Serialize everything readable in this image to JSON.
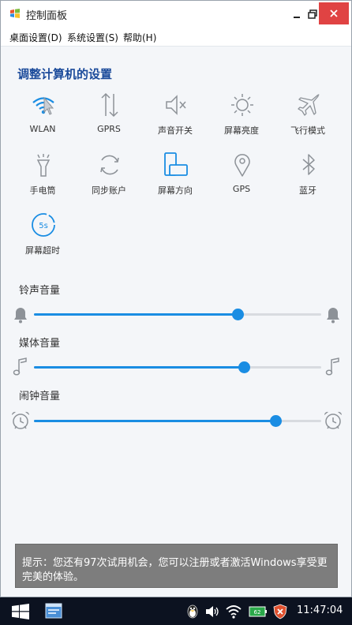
{
  "window": {
    "title": "控制面板"
  },
  "menu": [
    "桌面设置(D)",
    "系统设置(S)",
    "帮助(H)"
  ],
  "heading": "调整计算机的设置",
  "tiles": [
    {
      "label": "WLAN",
      "icon": "wlan-icon",
      "active": true
    },
    {
      "label": "GPRS",
      "icon": "gprs-icon",
      "active": false
    },
    {
      "label": "声音开关",
      "icon": "speaker-mute-icon",
      "active": false
    },
    {
      "label": "屏幕亮度",
      "icon": "brightness-icon",
      "active": false
    },
    {
      "label": "飞行模式",
      "icon": "airplane-icon",
      "active": false
    },
    {
      "label": "手电筒",
      "icon": "flashlight-icon",
      "active": false
    },
    {
      "label": "同步账户",
      "icon": "sync-icon",
      "active": false
    },
    {
      "label": "屏幕方向",
      "icon": "screen-orientation-icon",
      "active": true
    },
    {
      "label": "GPS",
      "icon": "location-pin-icon",
      "active": false
    },
    {
      "label": "蓝牙",
      "icon": "bluetooth-icon",
      "active": false
    },
    {
      "label": "屏幕超时",
      "icon": "timer-5s-icon",
      "active": true,
      "badge": "5s"
    }
  ],
  "volumes": [
    {
      "label": "铃声音量",
      "level": 0.71,
      "icon": "bell-icon"
    },
    {
      "label": "媒体音量",
      "level": 0.73,
      "icon": "music-note-icon"
    },
    {
      "label": "闹钟音量",
      "level": 0.84,
      "icon": "alarm-clock-icon"
    }
  ],
  "toast": "提示：您还有97次试用机会，您可以注册或者激活Windows享受更完美的体验。",
  "taskbar": {
    "clock": "11:47:04",
    "battery_text": "62"
  },
  "colors": {
    "accent": "#1a8de3",
    "heading": "#1a4a9a",
    "icon_gray": "#8d9298"
  }
}
